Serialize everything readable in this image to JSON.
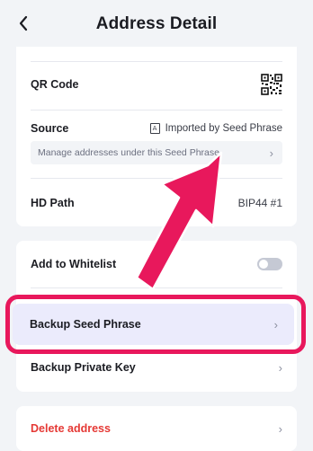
{
  "header": {
    "title": "Address Detail"
  },
  "qr": {
    "label": "QR Code"
  },
  "source": {
    "label": "Source",
    "value": "Imported by Seed Phrase",
    "manage_text": "Manage addresses under this Seed Phrase"
  },
  "hd_path": {
    "label": "HD Path",
    "value": "BIP44 #1"
  },
  "whitelist": {
    "label": "Add to Whitelist",
    "enabled": false
  },
  "backup_seed": {
    "label": "Backup Seed Phrase"
  },
  "backup_private": {
    "label": "Backup Private Key"
  },
  "delete": {
    "label": "Delete address"
  },
  "colors": {
    "accent": "#e8185c",
    "danger": "#e53935",
    "highlight": "#ebebfc"
  },
  "icons": [
    "back-arrow-icon",
    "qr-code-icon",
    "key-badge-icon",
    "chevron-right-icon",
    "toggle-switch",
    "annotation-arrow"
  ]
}
